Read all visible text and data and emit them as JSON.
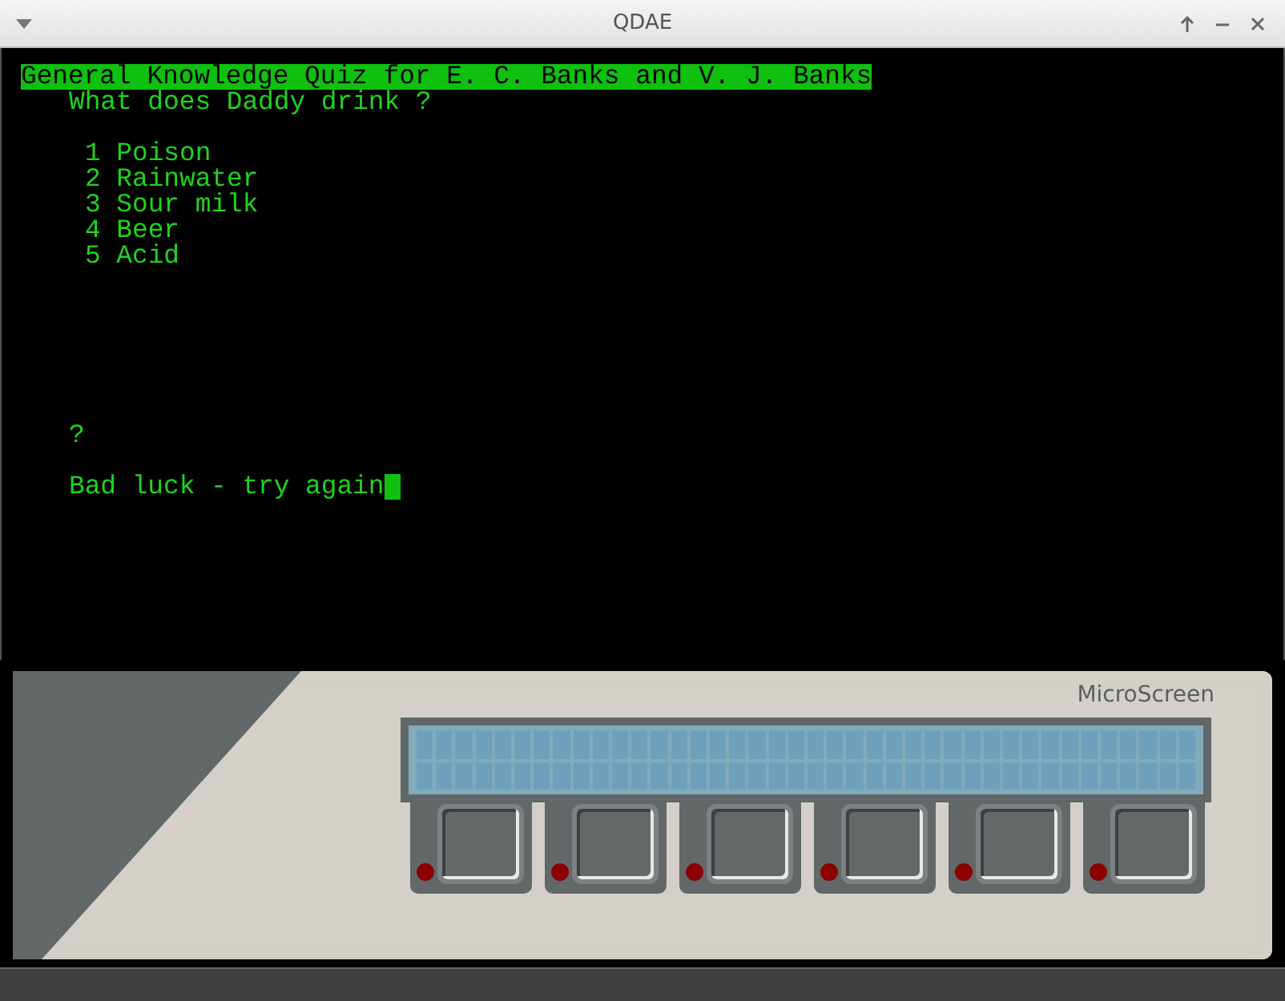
{
  "window": {
    "title": "QDAE"
  },
  "terminal": {
    "title": "General Knowledge Quiz for E. C. Banks and V. J. Banks",
    "question": "What does Daddy drink ?",
    "options": [
      {
        "number": "1",
        "label": "Poison"
      },
      {
        "number": "2",
        "label": "Rainwater"
      },
      {
        "number": "3",
        "label": "Sour milk"
      },
      {
        "number": "4",
        "label": "Beer"
      },
      {
        "number": "5",
        "label": "Acid"
      }
    ],
    "prompt": "?",
    "message": "Bad luck - try again"
  },
  "device": {
    "label": "MicroScreen"
  }
}
